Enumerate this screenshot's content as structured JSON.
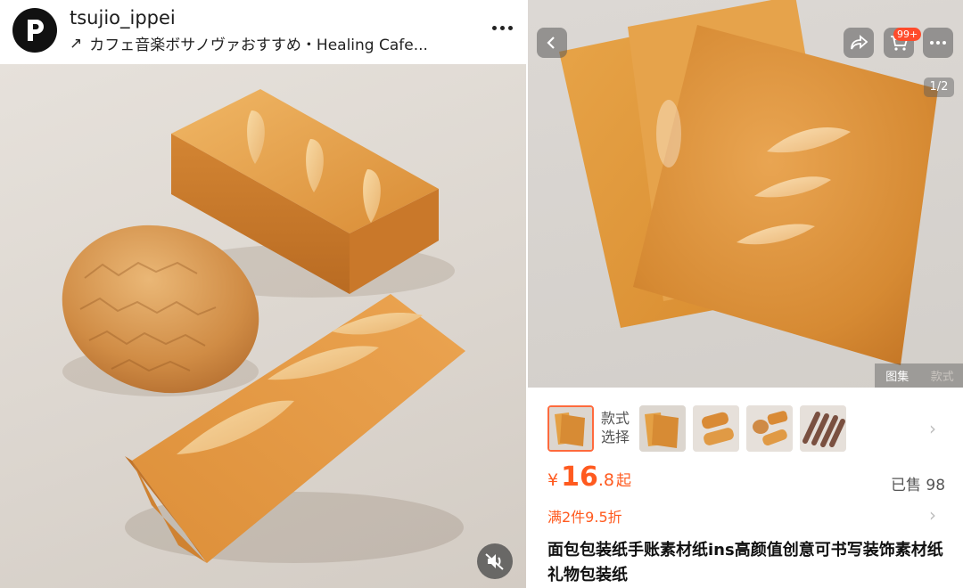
{
  "left_post": {
    "username": "tsujio_ippei",
    "music_arrow": "↗",
    "music_title": "カフェ音楽ボサノヴァおすすめ・Healing Cafe..."
  },
  "right_product": {
    "cart_badge": "99+",
    "page_indicator": "1/2",
    "gallery_tabs": [
      "图集",
      "款式"
    ],
    "style_label": "款式选择",
    "price": {
      "currency": "¥",
      "integer": "16",
      "decimal": ".8",
      "suffix": "起"
    },
    "sold": "已售 98",
    "promo": "满2件9.5折",
    "title": "面包包装纸手账素材纸ins高颜值创意可书写装饰素材纸礼物包装纸"
  },
  "colors": {
    "accent": "#ff5a1f",
    "badge": "#ff4b2b",
    "bread": "#e19a45"
  }
}
